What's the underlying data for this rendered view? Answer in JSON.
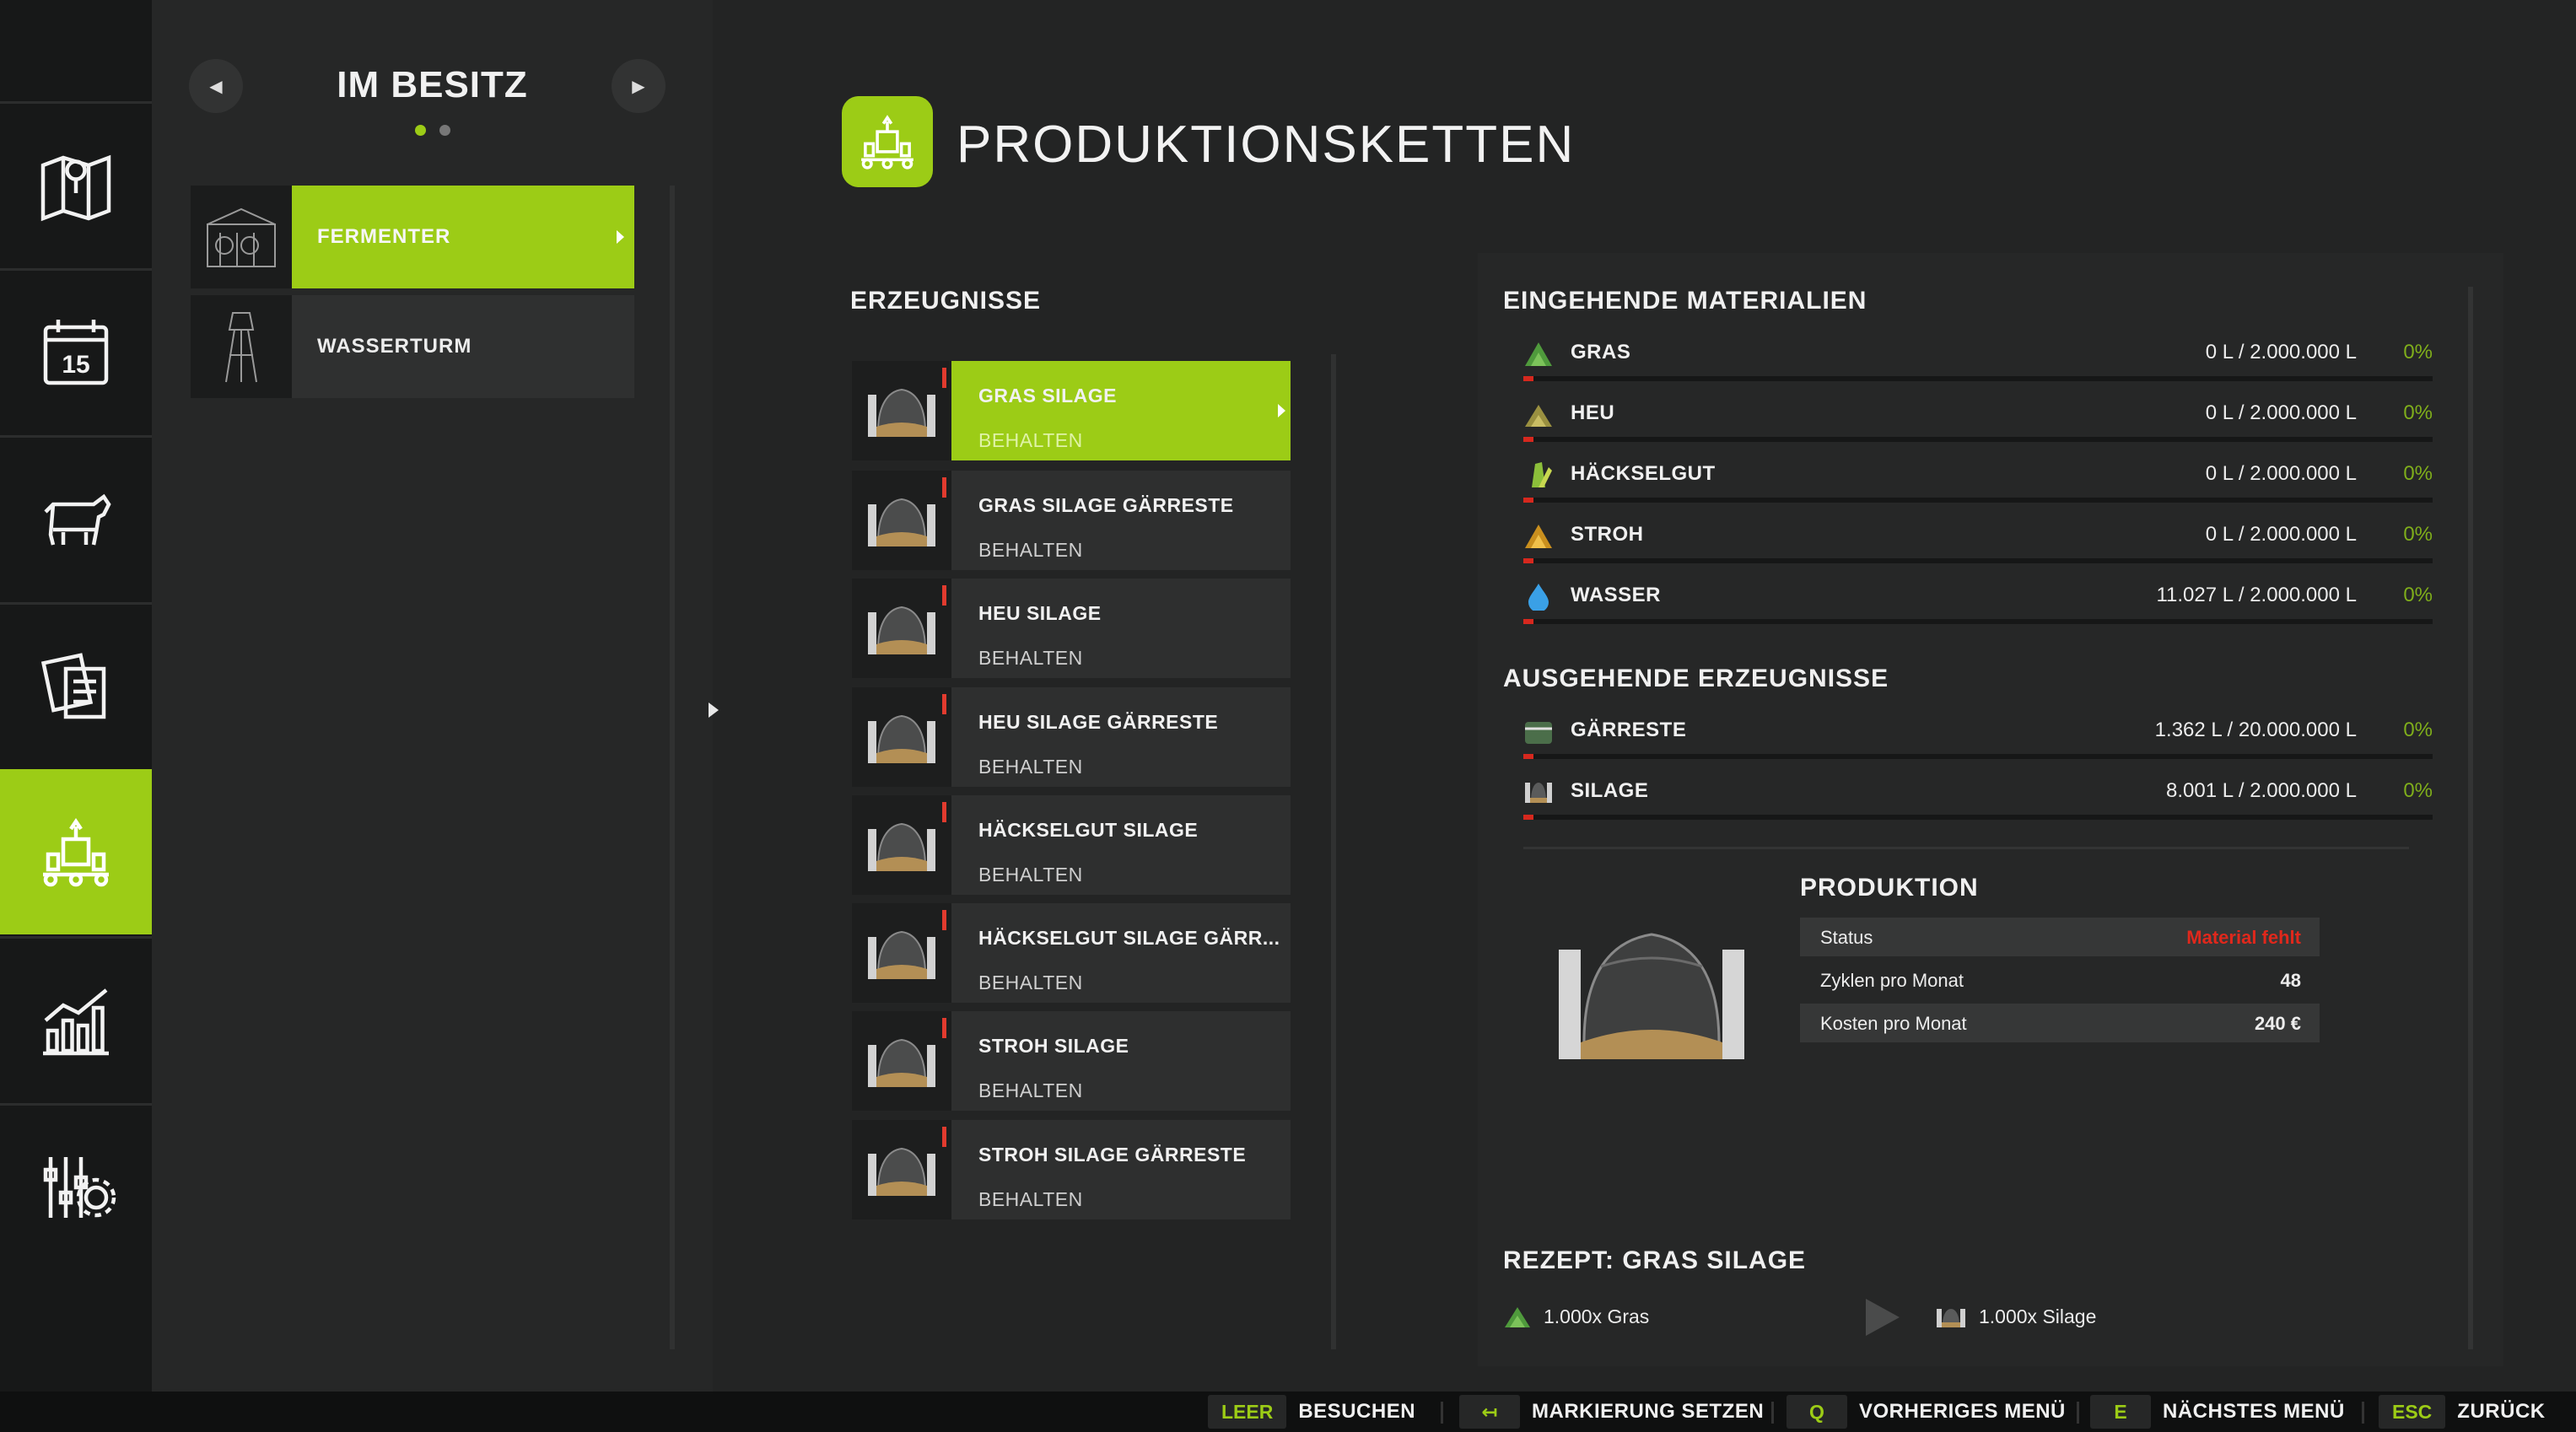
{
  "owned": {
    "title": "IM BESITZ",
    "items": [
      {
        "label": "FERMENTER",
        "active": true
      },
      {
        "label": "WASSERTURM",
        "active": false
      }
    ]
  },
  "header": {
    "title": "PRODUKTIONSKETTEN"
  },
  "products": {
    "title": "ERZEUGNISSE",
    "items": [
      {
        "name": "GRAS SILAGE",
        "mode": "BEHALTEN"
      },
      {
        "name": "GRAS SILAGE GÄRRESTE",
        "mode": "BEHALTEN"
      },
      {
        "name": "HEU SILAGE",
        "mode": "BEHALTEN"
      },
      {
        "name": "HEU SILAGE GÄRRESTE",
        "mode": "BEHALTEN"
      },
      {
        "name": "HÄCKSELGUT SILAGE",
        "mode": "BEHALTEN"
      },
      {
        "name": "HÄCKSELGUT SILAGE GÄRR...",
        "mode": "BEHALTEN"
      },
      {
        "name": "STROH SILAGE",
        "mode": "BEHALTEN"
      },
      {
        "name": "STROH SILAGE GÄRRESTE",
        "mode": "BEHALTEN"
      }
    ]
  },
  "incoming": {
    "title": "EINGEHENDE MATERIALIEN",
    "items": [
      {
        "name": "GRAS",
        "amount": "0 L / 2.000.000 L",
        "percent": "0%",
        "fill": 0.0,
        "icon": "grass-icon"
      },
      {
        "name": "HEU",
        "amount": "0 L / 2.000.000 L",
        "percent": "0%",
        "fill": 0.0,
        "icon": "hay-icon"
      },
      {
        "name": "HÄCKSELGUT",
        "amount": "0 L / 2.000.000 L",
        "percent": "0%",
        "fill": 0.0,
        "icon": "chaff-icon"
      },
      {
        "name": "STROH",
        "amount": "0 L / 2.000.000 L",
        "percent": "0%",
        "fill": 0.0,
        "icon": "straw-icon"
      },
      {
        "name": "WASSER",
        "amount": "11.027 L / 2.000.000 L",
        "percent": "0%",
        "fill": 0.0055,
        "icon": "water-icon"
      }
    ]
  },
  "outgoing": {
    "title": "AUSGEHENDE ERZEUGNISSE",
    "items": [
      {
        "name": "GÄRRESTE",
        "amount": "1.362 L / 20.000.000 L",
        "percent": "0%",
        "fill": 0.0001,
        "icon": "digestate-icon"
      },
      {
        "name": "SILAGE",
        "amount": "8.001 L / 2.000.000 L",
        "percent": "0%",
        "fill": 0.004,
        "icon": "silage-icon"
      }
    ]
  },
  "production": {
    "title": "PRODUKTION",
    "rows": [
      {
        "key": "Status",
        "value": "Material fehlt"
      },
      {
        "key": "Zyklen pro Monat",
        "value": "48"
      },
      {
        "key": "Kosten pro Monat",
        "value": "240 €"
      }
    ]
  },
  "recipe": {
    "title": "REZEPT: GRAS SILAGE",
    "input": "1.000x Gras",
    "output": "1.000x Silage"
  },
  "hints": [
    {
      "key": "LEER",
      "label": "BESUCHEN"
    },
    {
      "key": "↤",
      "label": "MARKIERUNG SETZEN"
    },
    {
      "key": "Q",
      "label": "VORHERIGES MENÜ"
    },
    {
      "key": "E",
      "label": "NÄCHSTES MENÜ"
    },
    {
      "key": "ESC",
      "label": "ZURÜCK"
    }
  ],
  "colors": {
    "accent": "#9ccc16",
    "error": "#e0281c",
    "percent": "#7fae1b"
  }
}
